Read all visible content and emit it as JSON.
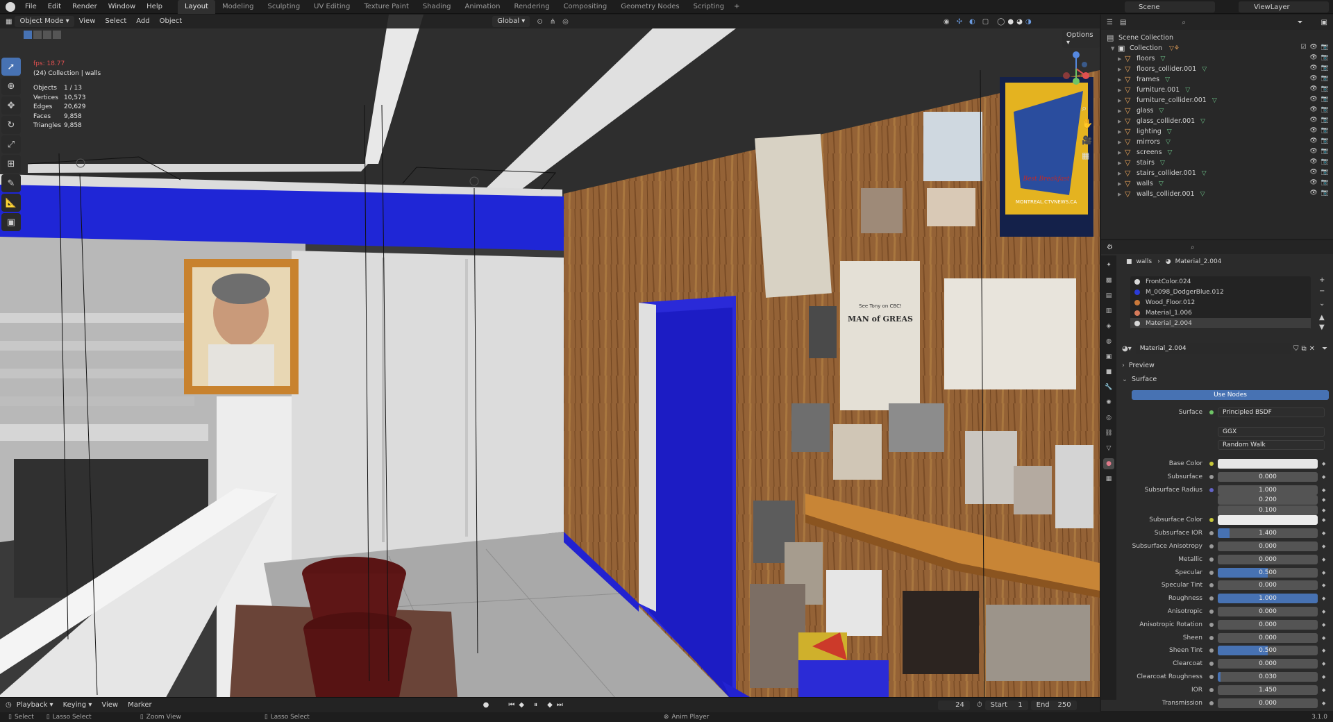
{
  "menu": [
    "File",
    "Edit",
    "Render",
    "Window",
    "Help"
  ],
  "workspaces": [
    "Layout",
    "Modeling",
    "Sculpting",
    "UV Editing",
    "Texture Paint",
    "Shading",
    "Animation",
    "Rendering",
    "Compositing",
    "Geometry Nodes",
    "Scripting"
  ],
  "active_workspace": "Layout",
  "scene_name": "Scene",
  "view_layer": "ViewLayer",
  "viewport_header": {
    "mode": "Object Mode",
    "menus": [
      "View",
      "Select",
      "Add",
      "Object"
    ],
    "orientation": "Global",
    "options": "Options"
  },
  "overlay": {
    "fps": "fps: 18.77",
    "context": "(24) Collection | walls",
    "stats": [
      {
        "label": "Objects",
        "value": "1 / 13"
      },
      {
        "label": "Vertices",
        "value": "10,573"
      },
      {
        "label": "Edges",
        "value": "20,629"
      },
      {
        "label": "Faces",
        "value": "9,858"
      },
      {
        "label": "Triangles",
        "value": "9,858"
      }
    ]
  },
  "toolbar_icons": [
    "cursor-select-icon",
    "3d-cursor-icon",
    "move-icon",
    "rotate-icon",
    "scale-icon",
    "transform-icon",
    "annotate-icon",
    "measure-icon",
    "add-cube-icon"
  ],
  "timeline": {
    "menus": [
      "Playback",
      "Keying",
      "View",
      "Marker"
    ],
    "current_frame": "24",
    "start_label": "Start",
    "start": "1",
    "end_label": "End",
    "end": "250"
  },
  "statusbar": {
    "items": [
      "Select",
      "Lasso Select",
      "Zoom View",
      "Lasso Select"
    ],
    "center": "Anim Player",
    "version": "3.1.0"
  },
  "outliner": {
    "root": "Scene Collection",
    "collection": "Collection",
    "objects": [
      "floors",
      "floors_collider.001",
      "frames",
      "furniture.001",
      "furniture_collider.001",
      "glass",
      "glass_collider.001",
      "lighting",
      "mirrors",
      "screens",
      "stairs",
      "stairs_collider.001",
      "walls",
      "walls_collider.001"
    ]
  },
  "properties": {
    "breadcrumb_object": "walls",
    "breadcrumb_material": "Material_2.004",
    "slots": [
      {
        "name": "FrontColor.024",
        "color": "#d8d8d8"
      },
      {
        "name": "M_0098_DodgerBlue.012",
        "color": "#2a3bd8"
      },
      {
        "name": "Wood_Floor.012",
        "color": "#c9783a"
      },
      {
        "name": "Material_1.006",
        "color": "#d67a5a"
      },
      {
        "name": "Material_2.004",
        "color": "#d8d8d8"
      }
    ],
    "material_name": "Material_2.004",
    "preview": "Preview",
    "surface_section": "Surface",
    "use_nodes": "Use Nodes",
    "surface_label": "Surface",
    "surface_value": "Principled BSDF",
    "distribution": "GGX",
    "subsurface_method": "Random Walk",
    "inputs": [
      {
        "label": "Base Color",
        "type": "color",
        "color": "#e6e6e6",
        "dot": "#c8c83a"
      },
      {
        "label": "Subsurface",
        "value": "0.000",
        "fill": 0,
        "dot": "#9a9a9a"
      },
      {
        "label": "Subsurface Radius",
        "value": "1.000",
        "dot": "#6363c7"
      },
      {
        "label": "",
        "value": "0.200"
      },
      {
        "label": "",
        "value": "0.100"
      },
      {
        "label": "Subsurface Color",
        "type": "color",
        "color": "#ececec",
        "dot": "#c8c83a"
      },
      {
        "label": "Subsurface IOR",
        "value": "1.400",
        "fill": 0.12,
        "dot": "#9a9a9a"
      },
      {
        "label": "Subsurface Anisotropy",
        "value": "0.000",
        "fill": 0,
        "dot": "#9a9a9a"
      },
      {
        "label": "Metallic",
        "value": "0.000",
        "fill": 0,
        "dot": "#9a9a9a"
      },
      {
        "label": "Specular",
        "value": "0.500",
        "fill": 0.5,
        "dot": "#9a9a9a"
      },
      {
        "label": "Specular Tint",
        "value": "0.000",
        "fill": 0,
        "dot": "#9a9a9a"
      },
      {
        "label": "Roughness",
        "value": "1.000",
        "fill": 1,
        "dot": "#9a9a9a"
      },
      {
        "label": "Anisotropic",
        "value": "0.000",
        "fill": 0,
        "dot": "#9a9a9a"
      },
      {
        "label": "Anisotropic Rotation",
        "value": "0.000",
        "fill": 0,
        "dot": "#9a9a9a"
      },
      {
        "label": "Sheen",
        "value": "0.000",
        "fill": 0,
        "dot": "#9a9a9a"
      },
      {
        "label": "Sheen Tint",
        "value": "0.500",
        "fill": 0.5,
        "dot": "#9a9a9a"
      },
      {
        "label": "Clearcoat",
        "value": "0.000",
        "fill": 0,
        "dot": "#9a9a9a"
      },
      {
        "label": "Clearcoat Roughness",
        "value": "0.030",
        "fill": 0.03,
        "dot": "#9a9a9a"
      },
      {
        "label": "IOR",
        "value": "1.450",
        "dot": "#9a9a9a"
      },
      {
        "label": "Transmission",
        "value": "0.000",
        "fill": 0,
        "dot": "#9a9a9a"
      }
    ]
  },
  "scene_poster": {
    "clipping_title": "MAN of GREAS",
    "clipping_sub": "See Tony on CBC!",
    "poster_text": "Best Breakfast",
    "poster_url": "MONTREAL.CTVNEWS.CA"
  }
}
